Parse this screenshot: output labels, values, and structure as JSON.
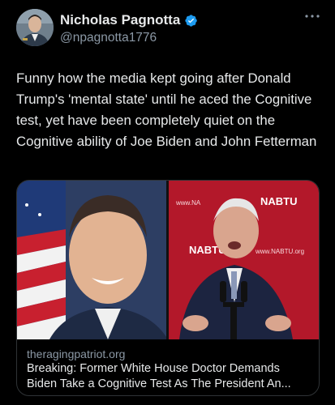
{
  "author": {
    "display_name": "Nicholas Pagnotta",
    "handle": "@npagnotta1776",
    "verified": true,
    "avatar_icon": "profile-photo"
  },
  "more_icon": "ellipsis-icon",
  "tweet": {
    "text": "Funny how the media kept going after Donald Trump's 'mental state' until he aced the Cognitive test, yet have been completely quiet on the Cognitive ability of Joe Biden and John Fetterman"
  },
  "link_card": {
    "domain": "theragingpatriot.org",
    "title_line1": "Breaking: Former White House Doctor Demands",
    "title_line2": "Biden Take a Cognitive Test As The President An...",
    "media_signage": [
      "www.NA",
      "NABTU",
      "NABTU",
      "www.NABTU.org"
    ]
  },
  "colors": {
    "background": "#000000",
    "text": "#e7e9ea",
    "muted": "#8b98a5",
    "verified_badge": "#1d9bf0",
    "border": "#2f3336",
    "signage_red": "#b3182a"
  }
}
